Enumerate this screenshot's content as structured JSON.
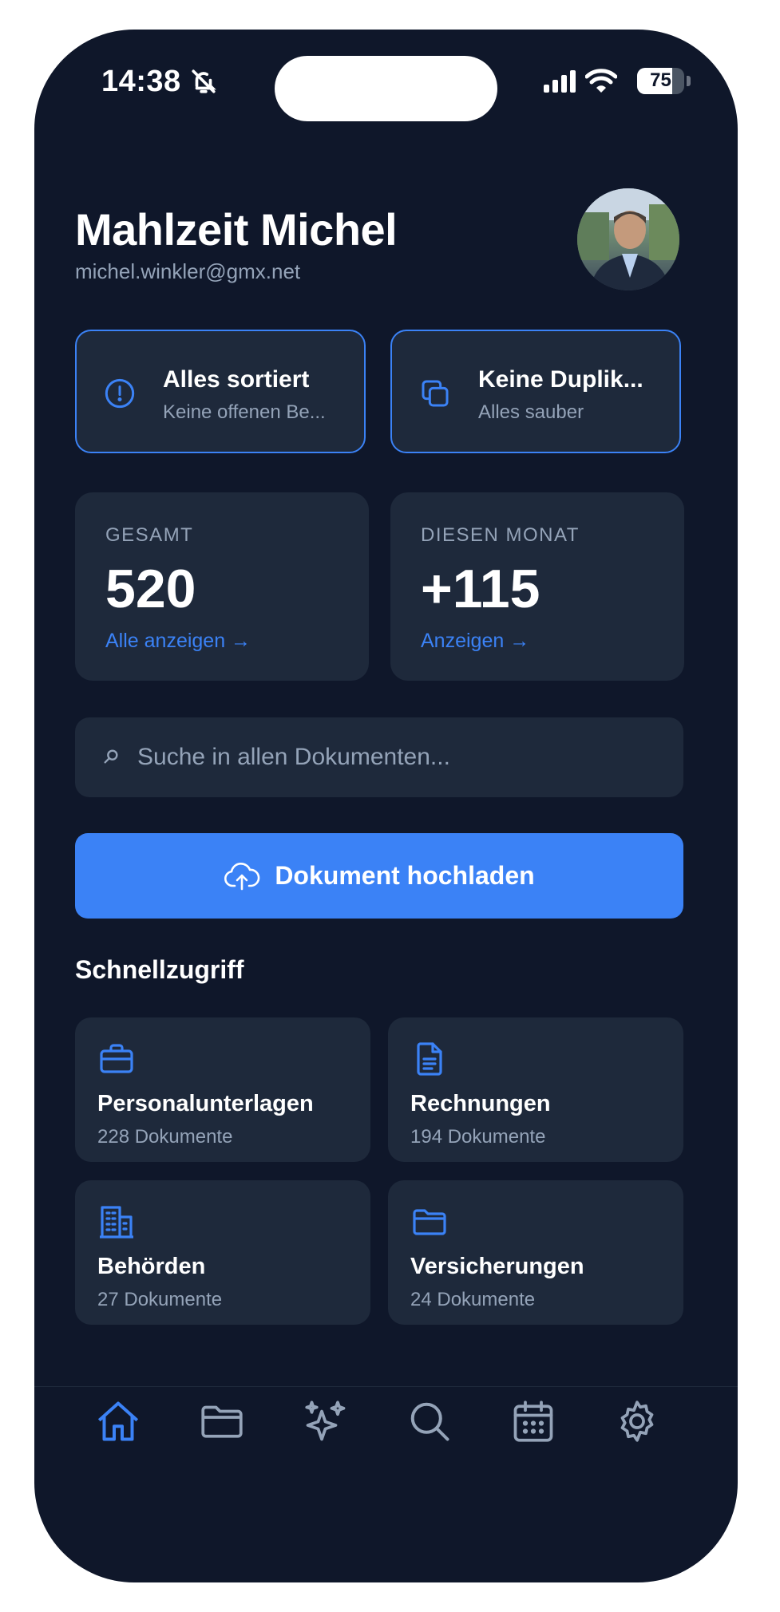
{
  "status_bar": {
    "time": "14:38",
    "battery": "75"
  },
  "header": {
    "greeting": "Mahlzeit Michel",
    "email": "michel.winkler@gmx.net"
  },
  "status_cards": [
    {
      "title": "Alles sortiert",
      "subtitle": "Keine offenen Be...",
      "icon": "alert-circle-icon"
    },
    {
      "title": "Keine Duplik...",
      "subtitle": "Alles sauber",
      "icon": "copy-icon"
    }
  ],
  "stats": [
    {
      "label": "GESAMT",
      "value": "520",
      "link": "Alle anzeigen →"
    },
    {
      "label": "DIESEN MONAT",
      "value": "+115",
      "link": "Anzeigen →"
    }
  ],
  "search": {
    "placeholder": "Suche in allen Dokumenten..."
  },
  "upload": {
    "label": "Dokument hochladen"
  },
  "quick_access": {
    "title": "Schnellzugriff",
    "items": [
      {
        "title": "Personalunterlagen",
        "count": "228 Dokumente",
        "icon": "briefcase-icon"
      },
      {
        "title": "Rechnungen",
        "count": "194 Dokumente",
        "icon": "file-text-icon"
      },
      {
        "title": "Behörden",
        "count": "27 Dokumente",
        "icon": "building-icon"
      },
      {
        "title": "Versicherungen",
        "count": "24 Dokumente",
        "icon": "folder-icon"
      }
    ]
  },
  "tab_bar": {
    "active": "home",
    "items": [
      "home-icon",
      "folder-icon",
      "sparkles-icon",
      "search-icon",
      "calendar-icon",
      "settings-icon"
    ]
  },
  "colors": {
    "background": "#0f172a",
    "card": "#1e293b",
    "accent": "#3b82f6",
    "muted_text": "#94a3b8"
  }
}
